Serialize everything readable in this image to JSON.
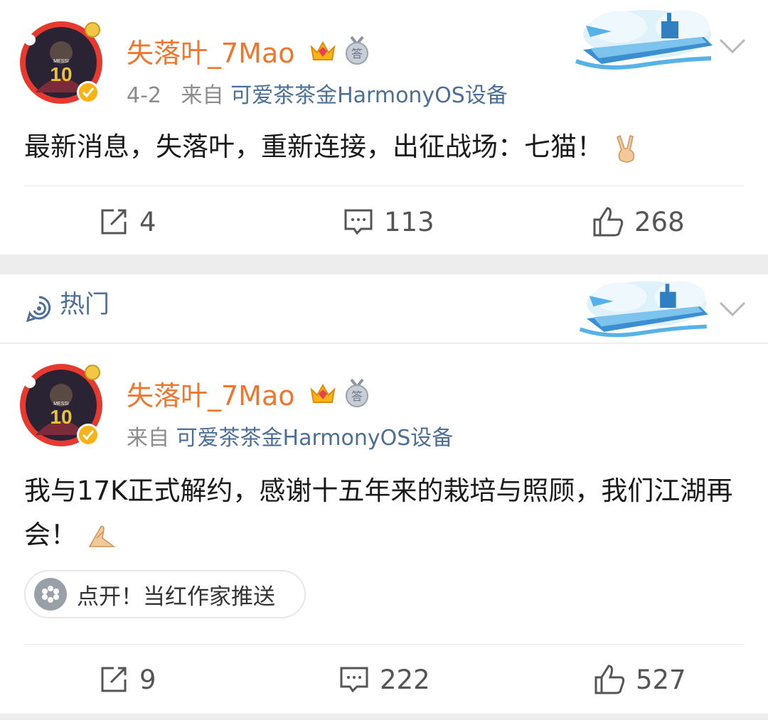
{
  "posts": [
    {
      "username": "失落叶_7Mao",
      "time": "4-2",
      "from_prefix": "来自",
      "source": "可爱茶茶金HarmonyOS设备",
      "content": "最新消息，失落叶，重新连接，出征战场：七猫！",
      "reposts": "4",
      "comments": "113",
      "likes": "268",
      "jersey": "10",
      "jersey_name": "MESSI"
    },
    {
      "username": "失落叶_7Mao",
      "from_prefix": "来自",
      "source": "可爱茶茶金HarmonyOS设备",
      "content": "我与17K正式解约，感谢十五年来的栽培与照顾，我们江湖再会！",
      "promo": "点开！当红作家推送",
      "reposts": "9",
      "comments": "222",
      "likes": "527",
      "jersey": "10",
      "jersey_name": "MESSI"
    }
  ],
  "hot_header": {
    "label": "热门"
  },
  "colors": {
    "username": "#f0762c",
    "link": "#4c6f97",
    "meta": "#8c8c8c",
    "divider": "#e8e8e8",
    "background": "#ededed"
  },
  "icons": [
    "repost-icon",
    "comment-icon",
    "like-icon",
    "crown-badge-icon",
    "medal-badge-icon",
    "verified-icon",
    "chevron-down-icon",
    "hot-icon",
    "promo-icon",
    "victory-hand-emoji",
    "clasped-hands-emoji"
  ],
  "badges": {
    "medal_char": "答"
  }
}
